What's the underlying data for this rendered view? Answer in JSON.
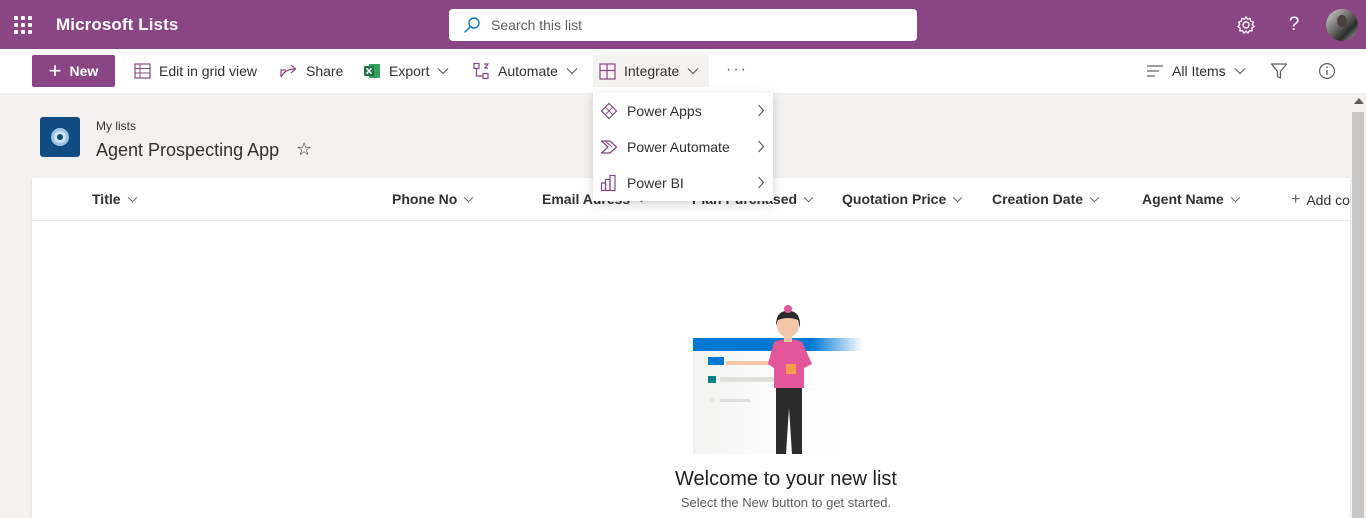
{
  "app": {
    "name": "Microsoft Lists"
  },
  "search": {
    "placeholder": "Search this list"
  },
  "toolbar": {
    "new_label": "New",
    "edit_grid_label": "Edit in grid view",
    "share_label": "Share",
    "export_label": "Export",
    "automate_label": "Automate",
    "integrate_label": "Integrate",
    "more_label": "···",
    "view_label": "All Items"
  },
  "header": {
    "breadcrumb": "My lists",
    "title": "Agent Prospecting App"
  },
  "columns": [
    "Title",
    "Phone No",
    "Email Adress",
    "Plan Purchased",
    "Quotation Price",
    "Creation Date",
    "Agent Name"
  ],
  "add_column_label": "Add co",
  "integrate_menu": {
    "items": [
      "Power Apps",
      "Power Automate",
      "Power BI"
    ]
  },
  "empty_state": {
    "title": "Welcome to your new list",
    "subtitle": "Select the New button to get started."
  },
  "colors": {
    "brand": "#8a4585",
    "excel": "#217346",
    "list_icon": "#0f4c81"
  }
}
